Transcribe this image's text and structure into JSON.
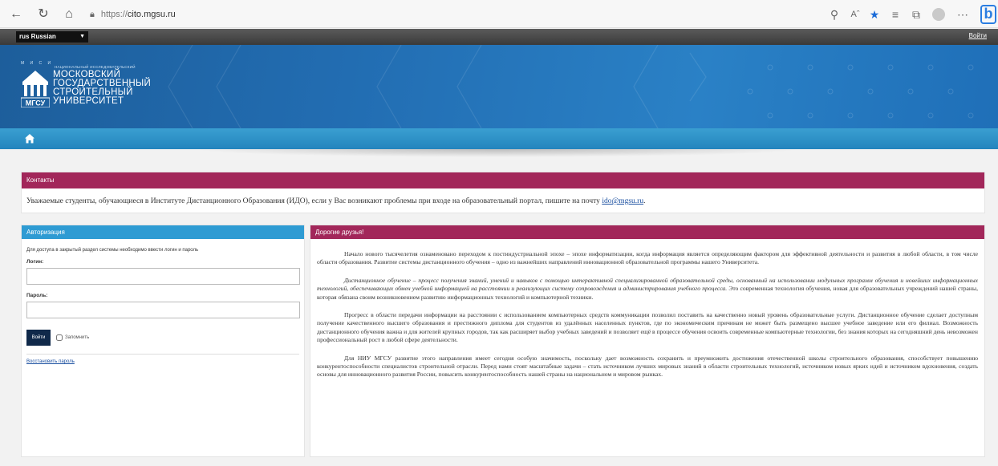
{
  "browser": {
    "url_scheme": "https://",
    "url_host": "cito.mgsu.ru",
    "bing_label": "b"
  },
  "topbar": {
    "language": "rus Russian",
    "login_label": "Войти"
  },
  "logo": {
    "top_letters": "М И С И",
    "subtitle": "НАЦИОНАЛЬНЫЙ ИССЛЕДОВАТЕЛЬСКИЙ",
    "name_lines": [
      "МОСКОВСКИЙ",
      "ГОСУДАРСТВЕННЫЙ",
      "СТРОИТЕЛЬНЫЙ",
      "УНИВЕРСИТЕТ"
    ],
    "abbr": "МГСУ"
  },
  "contacts": {
    "title": "Контакты",
    "text_before": "Уважаемые студенты, обучающиеся в Институте Дистанционного Образования (ИДО), если у Вас возникают проблемы при входе на образовательный портал, пишите на почту ",
    "email": "ido@mgsu.ru",
    "text_after": "."
  },
  "auth": {
    "title": "Авторизация",
    "hint": "Для доступа в закрытый раздел системы необходимо ввести логин и пароль",
    "login_label": "Логин:",
    "login_value": "",
    "password_label": "Пароль:",
    "password_value": "",
    "submit_label": "Войти",
    "remember_label": "Запомнить",
    "restore_label": "Восстановить пароль"
  },
  "friends": {
    "title": "Дорогие друзья!",
    "p1": "Начало нового тысячелетия ознаменовано переходом к постиндустриальной эпохе – эпохе информатизации, когда информация является определяющим фактором для эффективной деятельности и развития в любой области, в том числе области образования. Развитие системы дистанционного обучения – одно из важнейших направлений инновационной образовательной программы нашего Университета.",
    "p2_italic": "Дистанционное обучение – процесс получения знаний, умений и навыков с помощью интерактивной специализированной образовательной среды, основанный на использовании модульных программ обучения и новейших информационных технологий, обеспечивающих обмен учебной информацией на расстоянии и реализующих систему сопровождения и администрирования учебного процесса.",
    "p2_rest": " Это современная технология обучения, новая для образовательных учреждений нашей страны, которая обязана своим возникновением развитию информационных технологий и компьютерной техники.",
    "p3": "Прогресс в области передачи информации на расстоянии с использованием компьютерных средств коммуникации позволил поставить на качественно новый уровень образовательные услуги. Дистанционное обучение сделает доступным получение качественного высшего образования и престижного диплома для студентов из удалённых населенных пунктов, где по экономическим причинам не может быть размещено высшее учебное заведение или его филиал. Возможность дистанционного обучения важна и для жителей крупных городов, так как расширяет выбор учебных заведений и позволяет ещё в процессе обучения освоить современные компьютерные технологии, без знания которых на сегодняшний день невозможен профессиональный рост в любой сфере деятельности.",
    "p4": "Для НИУ МГСУ развитие этого направления имеет сегодня особую значимость, поскольку дает возможность сохранить и преумножить достижения отечественной школы строительного образования, способствует повышению конкурентоспособности специалистов строительной отрасли. Перед нами стоят масштабные задачи – стать источником лучших мировых знаний в области строительных технологий, источником новых ярких идей и источником вдохновения, создать основы для инновационного развития России, повысить конкурентоспособность нашей страны на национальном и мировом рынках."
  },
  "colors": {
    "header_blue": "#226db2",
    "nav_blue": "#2a8fc7",
    "panel_crimson": "#a2275a",
    "auth_blue": "#2e9bd3",
    "button_navy": "#10294a"
  }
}
